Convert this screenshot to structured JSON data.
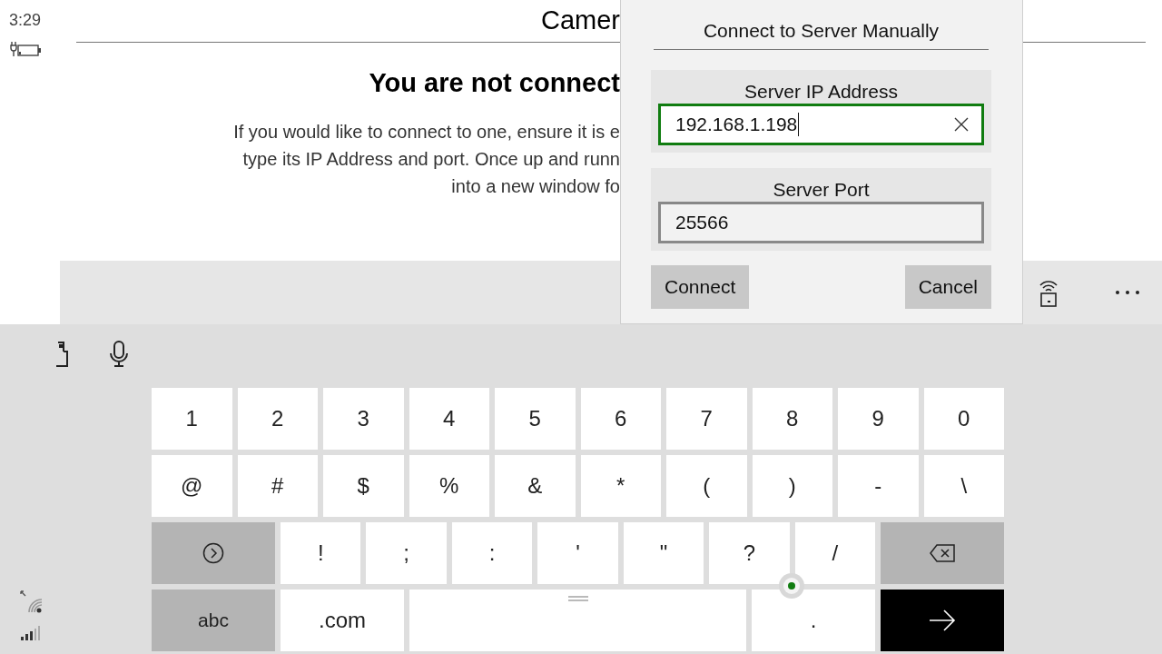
{
  "status": {
    "time": "3:29"
  },
  "app": {
    "title": "Camer",
    "heading": "You are not connect",
    "message_lines": [
      "If you would like to connect to one, ensure it is e",
      "type its IP Address and port. Once up and runn",
      "into a new window fo"
    ]
  },
  "dialog": {
    "title": "Connect to Server Manually",
    "fields": [
      {
        "label": "Server IP Address",
        "value": "192.168.1.198",
        "focused": true
      },
      {
        "label": "Server Port",
        "value": "25566",
        "focused": false
      }
    ],
    "buttons": [
      "Connect",
      "Cancel"
    ]
  },
  "keyboard": {
    "rows": [
      [
        {
          "kind": "char",
          "label": "1"
        },
        {
          "kind": "char",
          "label": "2"
        },
        {
          "kind": "char",
          "label": "3"
        },
        {
          "kind": "char",
          "label": "4"
        },
        {
          "kind": "char",
          "label": "5"
        },
        {
          "kind": "char",
          "label": "6"
        },
        {
          "kind": "char",
          "label": "7"
        },
        {
          "kind": "char",
          "label": "8"
        },
        {
          "kind": "char",
          "label": "9"
        },
        {
          "kind": "char",
          "label": "0"
        }
      ],
      [
        {
          "kind": "char",
          "label": "@"
        },
        {
          "kind": "char",
          "label": "#"
        },
        {
          "kind": "char",
          "label": "$"
        },
        {
          "kind": "char",
          "label": "%"
        },
        {
          "kind": "char",
          "label": "&"
        },
        {
          "kind": "char",
          "label": "*"
        },
        {
          "kind": "char",
          "label": "("
        },
        {
          "kind": "char",
          "label": ")"
        },
        {
          "kind": "char",
          "label": "-"
        },
        {
          "kind": "char",
          "label": "\\"
        }
      ],
      [
        {
          "kind": "next"
        },
        {
          "kind": "char",
          "label": "!"
        },
        {
          "kind": "char",
          "label": ";"
        },
        {
          "kind": "char",
          "label": ":"
        },
        {
          "kind": "char",
          "label": "'"
        },
        {
          "kind": "char",
          "label": "\""
        },
        {
          "kind": "char",
          "label": "?"
        },
        {
          "kind": "char",
          "label": "/"
        },
        {
          "kind": "backspace"
        }
      ],
      [
        {
          "kind": "mode",
          "label": "abc"
        },
        {
          "kind": "wide_char",
          "label": ".com"
        },
        {
          "kind": "space"
        },
        {
          "kind": "wide_char",
          "label": "."
        },
        {
          "kind": "enter"
        }
      ]
    ]
  }
}
